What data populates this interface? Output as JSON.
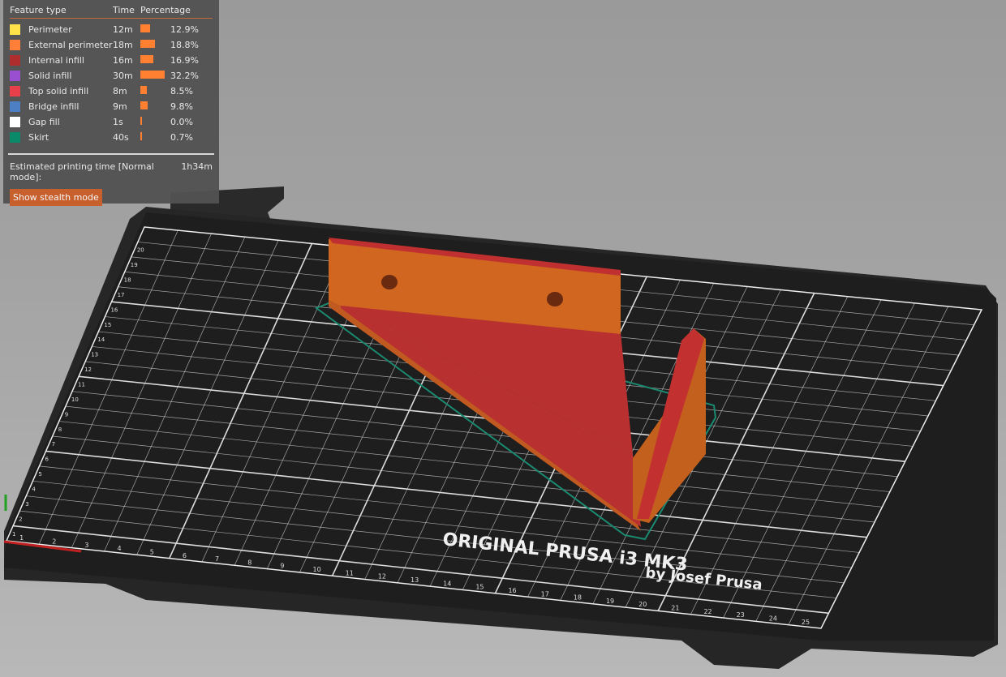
{
  "legend": {
    "headers": {
      "feature": "Feature type",
      "time": "Time",
      "percentage": "Percentage"
    },
    "items": [
      {
        "label": "Perimeter",
        "time": "12m",
        "pct": "12.9%",
        "value": 12.9,
        "color": "#ffe14a"
      },
      {
        "label": "External perimeter",
        "time": "18m",
        "pct": "18.8%",
        "value": 18.8,
        "color": "#ff7f38"
      },
      {
        "label": "Internal infill",
        "time": "16m",
        "pct": "16.9%",
        "value": 16.9,
        "color": "#b02d2d"
      },
      {
        "label": "Solid infill",
        "time": "30m",
        "pct": "32.2%",
        "value": 32.2,
        "color": "#9a4fd0"
      },
      {
        "label": "Top solid infill",
        "time": "8m",
        "pct": "8.5%",
        "value": 8.5,
        "color": "#e8404a"
      },
      {
        "label": "Bridge infill",
        "time": "9m",
        "pct": "9.8%",
        "value": 9.8,
        "color": "#4d7fc4"
      },
      {
        "label": "Gap fill",
        "time": "1s",
        "pct": "0.0%",
        "value": 0.0,
        "color": "#ffffff"
      },
      {
        "label": "Skirt",
        "time": "40s",
        "pct": "0.7%",
        "value": 0.7,
        "color": "#0b8a6a"
      }
    ],
    "estimate_label": "Estimated printing time [Normal mode]:",
    "estimate_value": "1h34m",
    "stealth_button": "Show stealth mode"
  },
  "bed": {
    "brand_line1": "ORIGINAL PRUSA i3 MK3",
    "brand_line2": "by Josef Prusa",
    "x_labels": [
      "1",
      "2",
      "3",
      "4",
      "5",
      "6",
      "7",
      "8",
      "9",
      "10",
      "11",
      "12",
      "13",
      "14",
      "15",
      "16",
      "17",
      "18",
      "19",
      "20",
      "21",
      "22",
      "23",
      "24",
      "25"
    ],
    "y_labels": [
      "1",
      "2",
      "3",
      "4",
      "5",
      "6",
      "7",
      "8",
      "9",
      "10",
      "11",
      "12",
      "13",
      "14",
      "15",
      "16",
      "17",
      "18",
      "19",
      "20"
    ]
  }
}
